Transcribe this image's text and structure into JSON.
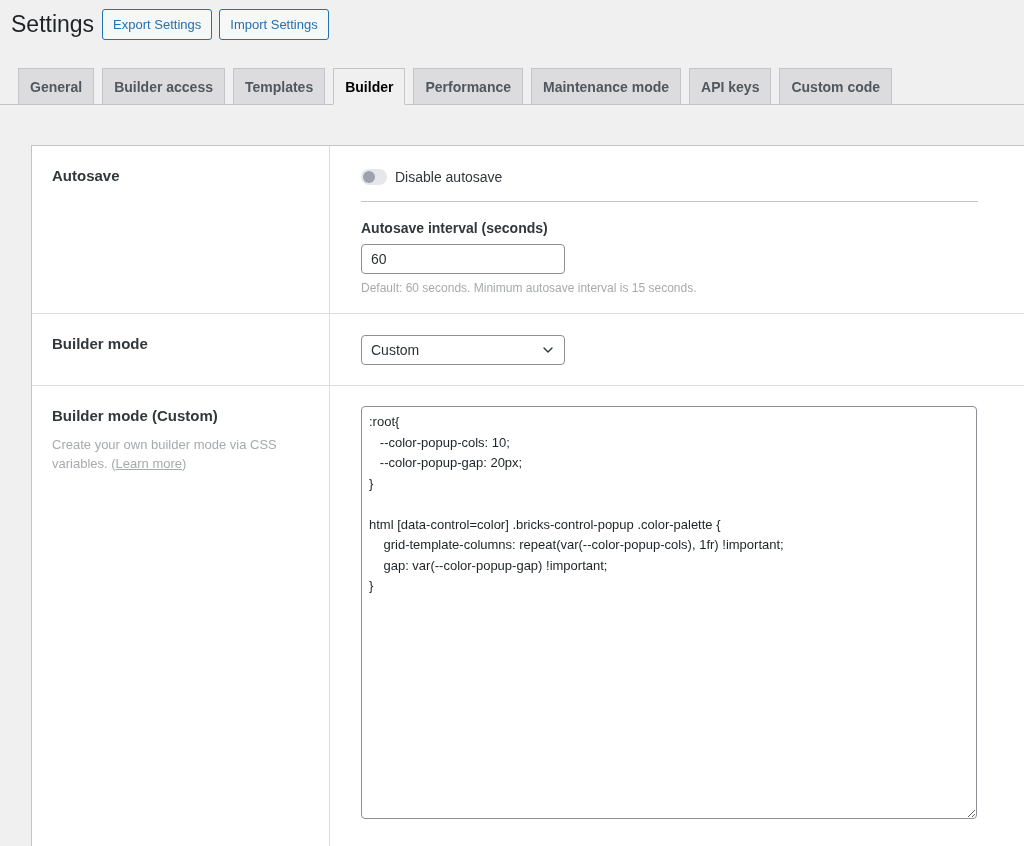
{
  "page": {
    "title": "Settings",
    "buttons": [
      "Export Settings",
      "Import Settings"
    ]
  },
  "tabs": [
    {
      "label": "General",
      "selected": false
    },
    {
      "label": "Builder access",
      "selected": false
    },
    {
      "label": "Templates",
      "selected": false
    },
    {
      "label": "Builder",
      "selected": true
    },
    {
      "label": "Performance",
      "selected": false
    },
    {
      "label": "Maintenance mode",
      "selected": false
    },
    {
      "label": "API keys",
      "selected": false
    },
    {
      "label": "Custom code",
      "selected": false
    }
  ],
  "autosave": {
    "label": "Autosave",
    "toggle": {
      "label": "Disable autosave",
      "on": false
    },
    "interval_label": "Autosave interval (seconds)",
    "interval_value": "60",
    "hint": "Default: 60 seconds. Minimum autosave interval is 15 seconds."
  },
  "builder_mode": {
    "label": "Builder mode",
    "value": "Custom"
  },
  "builder_mode_custom": {
    "label": "Builder mode (Custom)",
    "description_before": "Create your own builder mode via CSS variables. (",
    "link": "Learn more",
    "description_after": ")",
    "code": ":root{\n   --color-popup-cols: 10;\n   --color-popup-gap: 20px;\n}\n\nhtml [data-control=color] .bricks-control-popup .color-palette {\n    grid-template-columns: repeat(var(--color-popup-cols), 1fr) !important;\n    gap: var(--color-popup-gap) !important;\n}"
  }
}
